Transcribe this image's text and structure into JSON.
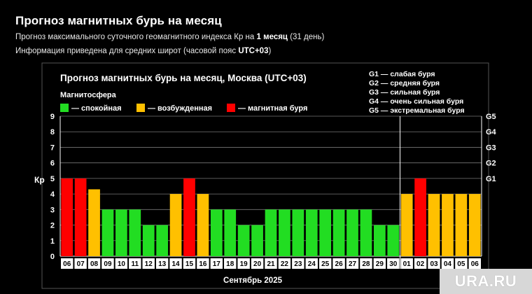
{
  "header": {
    "title": "Прогноз магнитных бурь на месяц",
    "line1_prefix": "Прогноз максимального суточного геомагнитного индекса Кр на ",
    "line1_bold": "1 месяц",
    "line1_suffix": " (31 день)",
    "line2_prefix": "Информация приведена для средних широт (часовой пояс ",
    "line2_bold": "UTC+03",
    "line2_suffix": ")"
  },
  "colors": {
    "calm": "#22dd22",
    "excited": "#ffc000",
    "storm": "#ff0000",
    "grid": "#777777",
    "frame": "#ffffff"
  },
  "watermark": {
    "text": "URA.RU"
  },
  "chart_data": {
    "type": "bar",
    "title": "Прогноз магнитных бурь на месяц, Москва (UTC+03)",
    "legend_title": "Магнитосфера",
    "legend": [
      {
        "key": "calm",
        "label": "— спокойная"
      },
      {
        "key": "excited",
        "label": "— возбужденная"
      },
      {
        "key": "storm",
        "label": "— магнитная буря"
      }
    ],
    "g_legend": [
      "G1 — слабая буря",
      "G2 — средняя буря",
      "G3 — сильная буря",
      "G4 — очень сильная буря",
      "G5 — экстремальная буря"
    ],
    "ylabel": "Кр",
    "ylim": [
      0,
      9
    ],
    "yticks": [
      "0",
      "1",
      "2",
      "3",
      "4",
      "5",
      "6",
      "7",
      "8",
      "9"
    ],
    "right_axis": [
      {
        "label": "G1",
        "kp": 5
      },
      {
        "label": "G2",
        "kp": 6
      },
      {
        "label": "G3",
        "kp": 7
      },
      {
        "label": "G4",
        "kp": 8
      },
      {
        "label": "G5",
        "kp": 9
      }
    ],
    "xlabel": "Сентябрь 2025",
    "month_divider_after_index": 24,
    "categories": [
      "06",
      "07",
      "08",
      "09",
      "10",
      "11",
      "12",
      "13",
      "14",
      "15",
      "16",
      "17",
      "18",
      "19",
      "20",
      "21",
      "22",
      "23",
      "24",
      "25",
      "26",
      "27",
      "28",
      "29",
      "30",
      "01",
      "02",
      "03",
      "04",
      "05",
      "06"
    ],
    "values": [
      5,
      5,
      4.3,
      3,
      3,
      3,
      2,
      2,
      4,
      5,
      4,
      3,
      3,
      2,
      2,
      3,
      3,
      3,
      3,
      3,
      3,
      3,
      3,
      2,
      2,
      4,
      5,
      4,
      4,
      4,
      4
    ],
    "status": [
      "storm",
      "storm",
      "excited",
      "calm",
      "calm",
      "calm",
      "calm",
      "calm",
      "excited",
      "storm",
      "excited",
      "calm",
      "calm",
      "calm",
      "calm",
      "calm",
      "calm",
      "calm",
      "calm",
      "calm",
      "calm",
      "calm",
      "calm",
      "calm",
      "calm",
      "excited",
      "storm",
      "excited",
      "excited",
      "excited",
      "excited"
    ],
    "grid": true
  }
}
